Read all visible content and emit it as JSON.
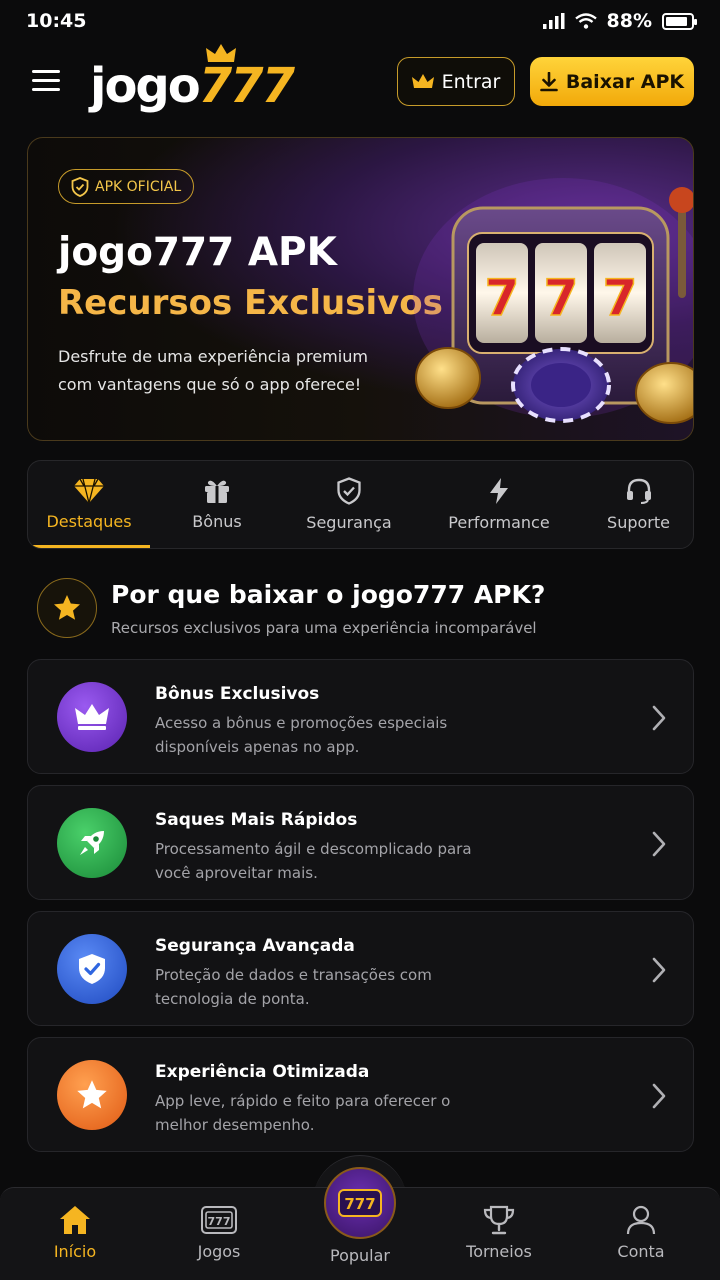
{
  "status": {
    "time": "10:45",
    "battery": "88%",
    "battery_level": 0.88
  },
  "header": {
    "logo_word": "jogo",
    "logo_digits": "777",
    "login_label": "Entrar",
    "download_label": "Baixar APK"
  },
  "hero": {
    "badge": "APK OFICIAL",
    "title": "jogo777 APK",
    "subtitle": "Recursos Exclusivos",
    "description": "Desfrute de uma experiência premium com vantagens que só o app oferece!"
  },
  "tabs": [
    {
      "label": "Destaques",
      "icon": "diamond-icon",
      "active": true
    },
    {
      "label": "Bônus",
      "icon": "gift-icon",
      "active": false
    },
    {
      "label": "Segurança",
      "icon": "shield-icon",
      "active": false
    },
    {
      "label": "Performance",
      "icon": "lightning-icon",
      "active": false
    },
    {
      "label": "Suporte",
      "icon": "headset-icon",
      "active": false
    }
  ],
  "section": {
    "title": "Por que baixar o jogo777 APK?",
    "subtitle": "Recursos exclusivos para uma experiência incomparável"
  },
  "features": [
    {
      "title": "Bônus Exclusivos",
      "description": "Acesso a bônus e promoções especiais disponíveis apenas no app.",
      "icon": "crown-icon",
      "color": "#7b3fd6"
    },
    {
      "title": "Saques Mais Rápidos",
      "description": "Processamento ágil e descomplicado para você aproveitar mais.",
      "icon": "rocket-icon",
      "color": "#2aa84a"
    },
    {
      "title": "Segurança Avançada",
      "description": "Proteção de dados e transações com tecnologia de ponta.",
      "icon": "shield-check-icon",
      "color": "#2f66e0"
    },
    {
      "title": "Experiência Otimizada",
      "description": "App leve, rápido e feito para oferecer o melhor desempenho.",
      "icon": "star-icon",
      "color": "#f07a22"
    }
  ],
  "bottom_nav": [
    {
      "label": "Início",
      "icon": "home-icon",
      "active": true
    },
    {
      "label": "Jogos",
      "icon": "slot-icon",
      "active": false
    },
    {
      "label": "Popular",
      "icon": "777-icon",
      "active": false
    },
    {
      "label": "Torneios",
      "icon": "trophy-icon",
      "active": false
    },
    {
      "label": "Conta",
      "icon": "user-icon",
      "active": false
    }
  ],
  "colors": {
    "accent": "#f5b521",
    "background": "#0b0b0c",
    "card": "#121214"
  }
}
